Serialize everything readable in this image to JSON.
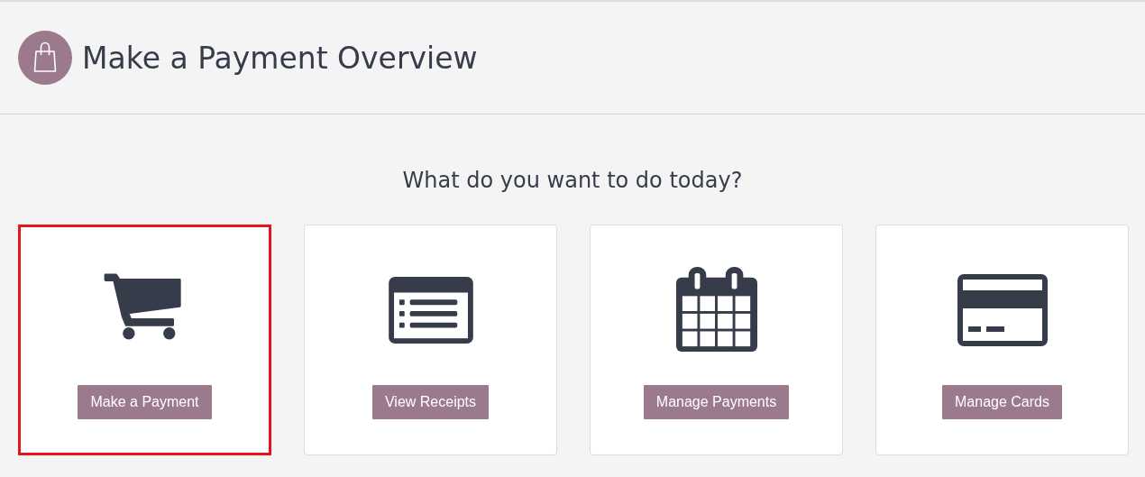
{
  "header": {
    "title": "Make a Payment Overview"
  },
  "prompt": "What do you want to do today?",
  "actions": [
    {
      "kind": "cart",
      "label": "Make a Payment",
      "selected": true
    },
    {
      "kind": "list",
      "label": "View Receipts",
      "selected": false
    },
    {
      "kind": "calendar",
      "label": "Manage Payments",
      "selected": false
    },
    {
      "kind": "card",
      "label": "Manage Cards",
      "selected": false
    }
  ]
}
